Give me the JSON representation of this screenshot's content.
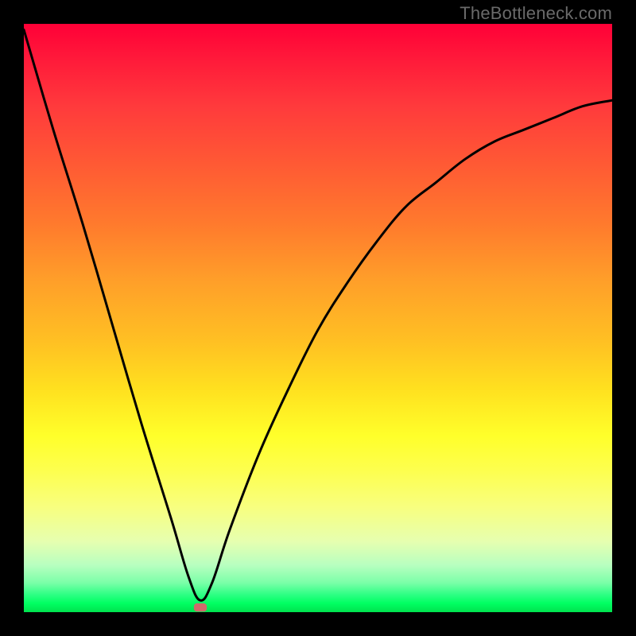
{
  "watermark": "TheBottleneck.com",
  "chart_data": {
    "type": "line",
    "title": "",
    "xlabel": "",
    "ylabel": "",
    "xlim": [
      0,
      100
    ],
    "ylim": [
      0,
      100
    ],
    "grid": false,
    "legend": false,
    "series": [
      {
        "name": "bottleneck-curve",
        "x": [
          0,
          5,
          10,
          15,
          20,
          25,
          28,
          30,
          32,
          35,
          40,
          45,
          50,
          55,
          60,
          65,
          70,
          75,
          80,
          85,
          90,
          95,
          100
        ],
        "y": [
          99,
          82,
          66,
          49,
          32,
          16,
          6,
          2,
          5,
          14,
          27,
          38,
          48,
          56,
          63,
          69,
          73,
          77,
          80,
          82,
          84,
          86,
          87
        ]
      }
    ],
    "marker": {
      "x": 30,
      "y": 0.8,
      "width": 2.2,
      "height": 1.4,
      "color": "#cf6b6b"
    },
    "background_gradient": {
      "type": "vertical",
      "stops": [
        {
          "pos": 0.0,
          "color": "#ff0037"
        },
        {
          "pos": 0.24,
          "color": "#ff5a34"
        },
        {
          "pos": 0.54,
          "color": "#ffc023"
        },
        {
          "pos": 0.76,
          "color": "#fdff4f"
        },
        {
          "pos": 0.92,
          "color": "#b8ffc0"
        },
        {
          "pos": 1.0,
          "color": "#00e24e"
        }
      ]
    }
  }
}
